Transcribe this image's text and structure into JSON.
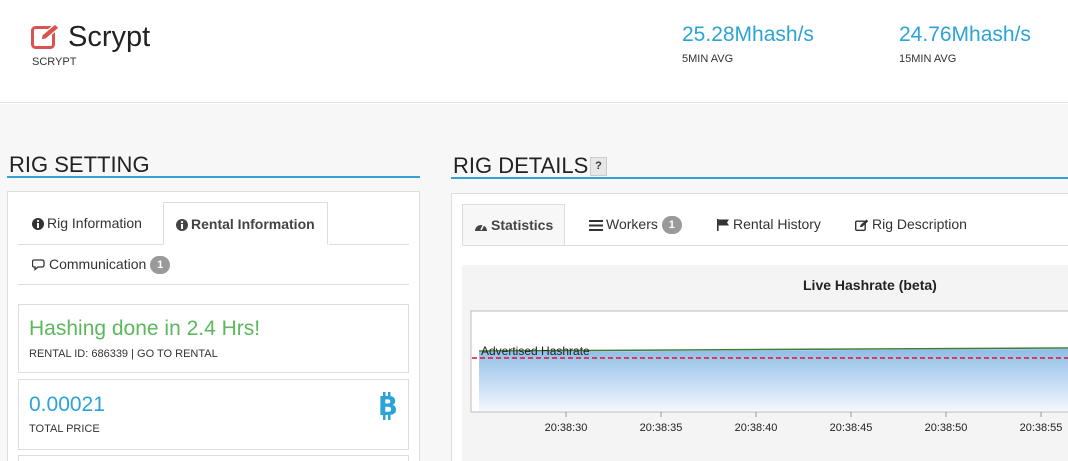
{
  "header": {
    "algo_title": "Scrypt",
    "algo_sub": "SCRYPT",
    "stat_5min": {
      "value": "25.28Mhash/s",
      "label": "5MIN AVG"
    },
    "stat_15min": {
      "value": "24.76Mhash/s",
      "label": "15MIN AVG"
    },
    "icon": "edit-icon"
  },
  "rig_setting": {
    "title": "RIG SETTING",
    "tabs": [
      {
        "label": "Rig Information",
        "icon": "info-circle-icon"
      },
      {
        "label": "Rental Information",
        "icon": "info-circle-icon",
        "active": true
      },
      {
        "label": "Communication",
        "icon": "comments-icon",
        "badge": "1"
      }
    ],
    "status": {
      "text": "Hashing done in 2.4 Hrs!",
      "rental_prefix": "RENTAL ID: 686339 | ",
      "rental_link": "GO TO RENTAL"
    },
    "price": {
      "value": "0.00021",
      "label": "TOTAL PRICE",
      "icon": "bitcoin-icon"
    }
  },
  "rig_details": {
    "title": "RIG DETAILS",
    "help": "?",
    "tabs": [
      {
        "label": "Statistics",
        "icon": "dashboard-icon",
        "active": true
      },
      {
        "label": "Workers",
        "icon": "list-icon",
        "badge": "1"
      },
      {
        "label": "Rental History",
        "icon": "flag-icon"
      },
      {
        "label": "Rig Description",
        "icon": "edit-icon"
      }
    ]
  },
  "colors": {
    "accent": "#2ca3d6",
    "success": "#5cb85c",
    "advertised_line": "#e0142b",
    "series_line": "#3a7d3a"
  },
  "chart_data": {
    "type": "area",
    "title": "Live Hashrate (beta)",
    "x": [
      "20:38:30",
      "20:38:35",
      "20:38:40",
      "20:38:45",
      "20:38:50",
      "20:38:55"
    ],
    "annotations": [
      {
        "label": "Advertised Hashrate",
        "style": "dashed",
        "color": "#e0142b"
      }
    ],
    "grid": true
  }
}
